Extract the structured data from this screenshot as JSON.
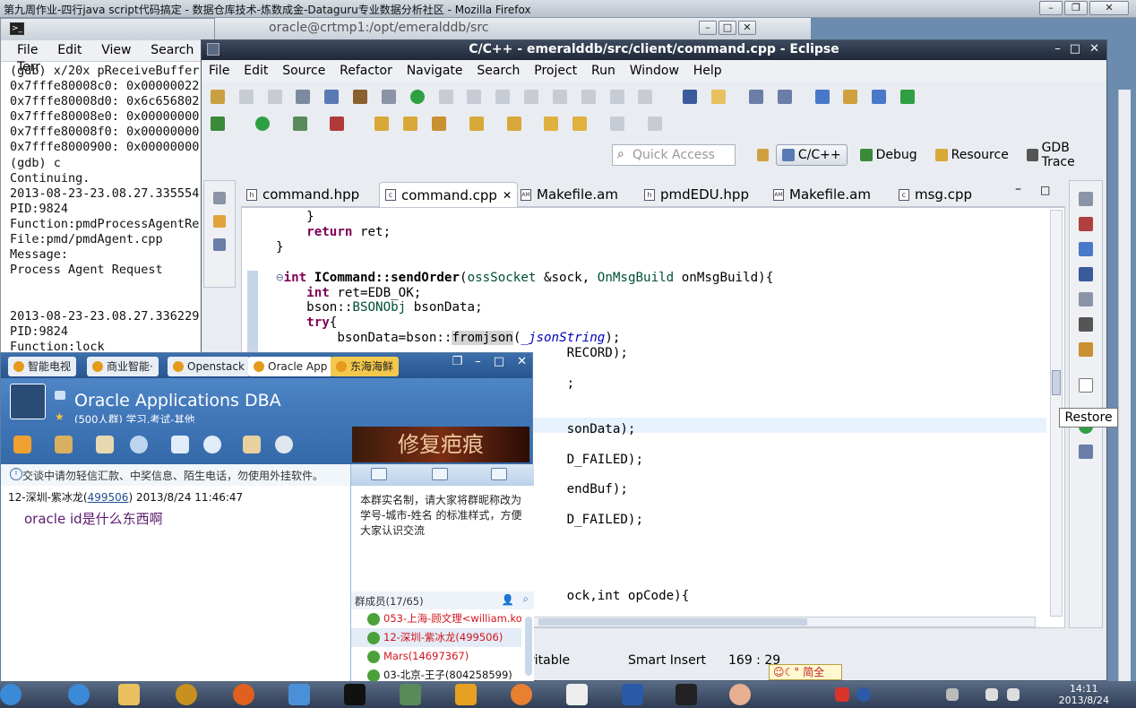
{
  "firefox": {
    "title": "第九周作业-四行java script代码搞定 - 数据仓库技术-炼数成金-Dataguru专业数据分析社区 - Mozilla Firefox"
  },
  "terminal": {
    "title": "oracle@crtmp1:/opt/emeralddb/src",
    "menu": [
      "File",
      "Edit",
      "View",
      "Search",
      "Terr"
    ],
    "lines": [
      "(gdb) x/20x pReceiveBuffer",
      "0x7fffe80008c0: 0x00000022",
      "0x7fffe80008d0: 0x6c656802",
      "0x7fffe80008e0: 0x00000000",
      "0x7fffe80008f0: 0x00000000",
      "0x7fffe8000900: 0x00000000",
      "(gdb) c",
      "Continuing.",
      "2013-08-23-23.08.27.335554",
      "PID:9824",
      "Function:pmdProcessAgentRe",
      "File:pmd/pmdAgent.cpp",
      "Message:",
      "Process Agent Request",
      "",
      "",
      "2013-08-23-23.08.27.336229",
      "PID:9824",
      "Function:lock"
    ]
  },
  "eclipse": {
    "title": "C/C++ - emeralddb/src/client/command.cpp - Eclipse",
    "menu": [
      "File",
      "Edit",
      "Source",
      "Refactor",
      "Navigate",
      "Search",
      "Project",
      "Run",
      "Window",
      "Help"
    ],
    "quick_access_placeholder": "Quick Access",
    "perspectives": [
      "C/C++",
      "Debug",
      "Resource",
      "GDB Trace"
    ],
    "tabs": [
      "command.hpp",
      "command.cpp",
      "Makefile.am",
      "pmdEDU.hpp",
      "Makefile.am",
      "msg.cpp"
    ],
    "tab_icons": [
      "h",
      "c",
      "AM",
      "h",
      "AM",
      "c"
    ],
    "restore_tooltip": "Restore",
    "status": {
      "writable": "ritable",
      "insert_mode": "Smart Insert",
      "position": "169 : 29"
    },
    "code_tail": [
      "RECORD);",
      ";",
      "sonData);",
      "D_FAILED);",
      "endBuf);",
      "D_FAILED);",
      "ock,int opCode){"
    ]
  },
  "qq": {
    "tabs": [
      "智能电视",
      "商业智能·",
      "Openstack",
      "Oracle App",
      "东海海鲜"
    ],
    "group_name": "Oracle Applications DBA",
    "group_info": "(500人群) 学习,考试-其他",
    "ad_text": "修复疤痕",
    "warning": "交谈中请勿轻信汇款、中奖信息、陌生电话，勿使用外挂软件。",
    "message": {
      "sender": "12-深圳-紫冰龙(",
      "sender_id": "499506",
      "sender_close": ")",
      "time": "2013/8/24 11:46:47",
      "text": "oracle id是什么东西啊"
    },
    "notice": "本群实名制，请大家将群昵称改为学号-城市-姓名 的标准样式，方便大家认识交流",
    "members_header": "群成员(17/65)",
    "members": [
      "053-上海-顾文理<william.ko...",
      "12-深圳-紫冰龙(499506)",
      "Mars(14697367)",
      "03-北京-王子(804258599)"
    ]
  },
  "taskbar": {
    "time": "14:11",
    "date": "2013/8/24"
  },
  "ime": {
    "label": "简全"
  }
}
